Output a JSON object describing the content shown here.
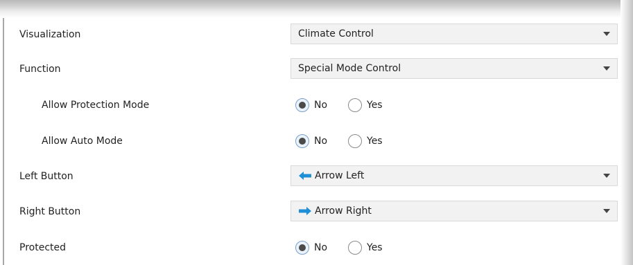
{
  "rows": [
    {
      "label": "Visualization",
      "type": "select",
      "value": "Climate Control"
    },
    {
      "label": "Function",
      "type": "select",
      "value": "Special Mode Control"
    },
    {
      "label": "Allow Protection Mode",
      "type": "radio",
      "options": [
        "No",
        "Yes"
      ],
      "selected": "No"
    },
    {
      "label": "Allow Auto Mode",
      "type": "radio",
      "options": [
        "No",
        "Yes"
      ],
      "selected": "No"
    },
    {
      "label": "Left Button",
      "type": "select",
      "value": "Arrow Left",
      "icon": "arrow-left-icon"
    },
    {
      "label": "Right Button",
      "type": "select",
      "value": "Arrow Right",
      "icon": "arrow-right-icon"
    },
    {
      "label": "Protected",
      "type": "radio",
      "options": [
        "No",
        "Yes"
      ],
      "selected": "No"
    }
  ],
  "colors": {
    "icon_blue": "#1e8fd6",
    "dropdown_bg": "#f2f2f2",
    "text": "#222222"
  }
}
